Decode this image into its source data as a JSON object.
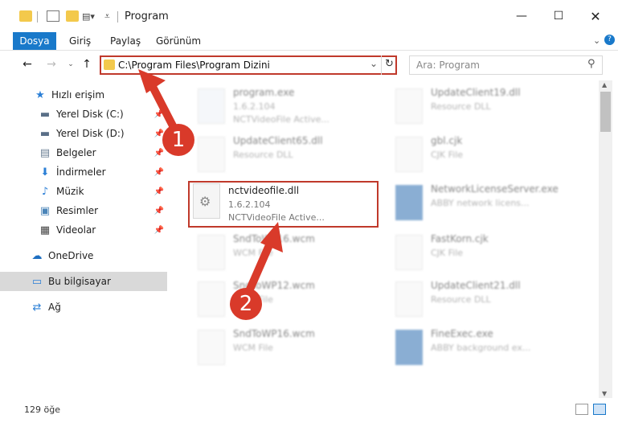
{
  "window": {
    "title": "Program"
  },
  "ribbon": {
    "tabs": [
      {
        "label": "Dosya"
      },
      {
        "label": "Giriş"
      },
      {
        "label": "Paylaş"
      },
      {
        "label": "Görünüm"
      }
    ]
  },
  "address": {
    "path": "C:\\Program Files\\Program Dizini"
  },
  "search": {
    "placeholder": "Ara: Program"
  },
  "sidebar": {
    "items": [
      {
        "label": "Hızlı erişim"
      },
      {
        "label": "Yerel Disk (C:)"
      },
      {
        "label": "Yerel Disk (D:)"
      },
      {
        "label": "Belgeler"
      },
      {
        "label": "İndirmeler"
      },
      {
        "label": "Müzik"
      },
      {
        "label": "Resimler"
      },
      {
        "label": "Videolar"
      },
      {
        "label": "OneDrive"
      },
      {
        "label": "Bu bilgisayar"
      },
      {
        "label": "Ağ"
      }
    ]
  },
  "files": {
    "left": [
      {
        "name": "program.exe",
        "line1": "1.6.2.104",
        "line2": "NCTVideoFile Active..."
      },
      {
        "name": "UpdateClient65.dll",
        "line1": "Resource DLL",
        "line2": ""
      },
      {
        "name": "nctvideofile.dll",
        "line1": "1.6.2.104",
        "line2": "NCTVideoFile Active..."
      },
      {
        "name": "SndToWP16.wcm",
        "line1": "WCM File",
        "line2": ""
      },
      {
        "name": "SndToWP12.wcm",
        "line1": "WCM File",
        "line2": ""
      },
      {
        "name": "SndToWP16.wcm",
        "line1": "WCM File",
        "line2": ""
      }
    ],
    "right": [
      {
        "name": "UpdateClient19.dll",
        "line1": "Resource DLL",
        "line2": ""
      },
      {
        "name": "gbl.cjk",
        "line1": "CJK File",
        "line2": ""
      },
      {
        "name": "NetworkLicenseServer.exe",
        "line1": "ABBY network licens...",
        "line2": ""
      },
      {
        "name": "FastKorn.cjk",
        "line1": "CJK File",
        "line2": ""
      },
      {
        "name": "UpdateClient21.dll",
        "line1": "Resource DLL",
        "line2": ""
      },
      {
        "name": "FineExec.exe",
        "line1": "ABBY background ex...",
        "line2": ""
      }
    ]
  },
  "status": {
    "count": "129 öğe"
  },
  "callouts": {
    "one": "1",
    "two": "2"
  },
  "colors": {
    "accent": "#1979ca",
    "highlight": "#c0392b",
    "callout": "#d93a2a"
  }
}
